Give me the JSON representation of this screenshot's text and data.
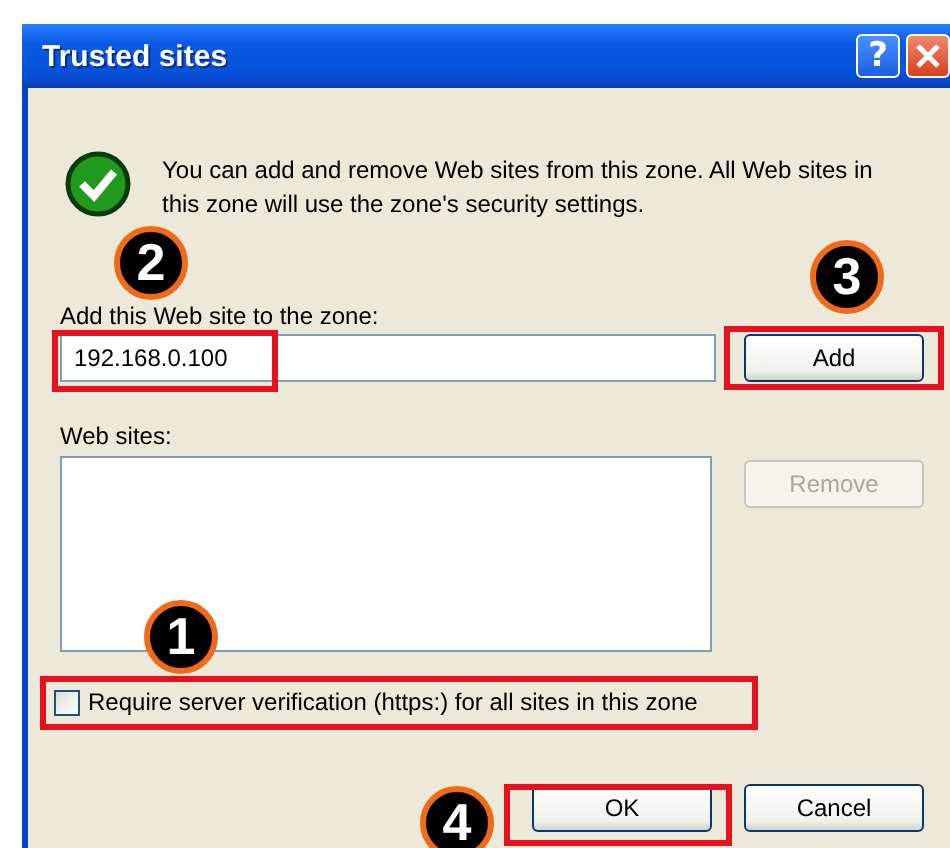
{
  "window": {
    "title": "Trusted sites",
    "help_button": "?"
  },
  "info": "You can add and remove Web sites from this zone. All Web sites in this zone will use the zone's security settings.",
  "add_site": {
    "label": "Add this Web site to the zone:",
    "value": "192.168.0.100",
    "highlighted": true,
    "callout": "2"
  },
  "add_button": {
    "label": "Add",
    "disabled": false,
    "highlighted": true,
    "callout": "3"
  },
  "sites": {
    "label": "Web sites:"
  },
  "remove_button": {
    "label": "Remove",
    "disabled": true
  },
  "require_https": {
    "label": "Require server verification (https:) for all sites in this zone",
    "checked": false,
    "highlighted": true,
    "callout": "1"
  },
  "buttons": [
    {
      "label": "OK",
      "disabled": false,
      "highlighted": true,
      "callout": "4"
    },
    {
      "label": "Cancel",
      "disabled": false
    }
  ]
}
